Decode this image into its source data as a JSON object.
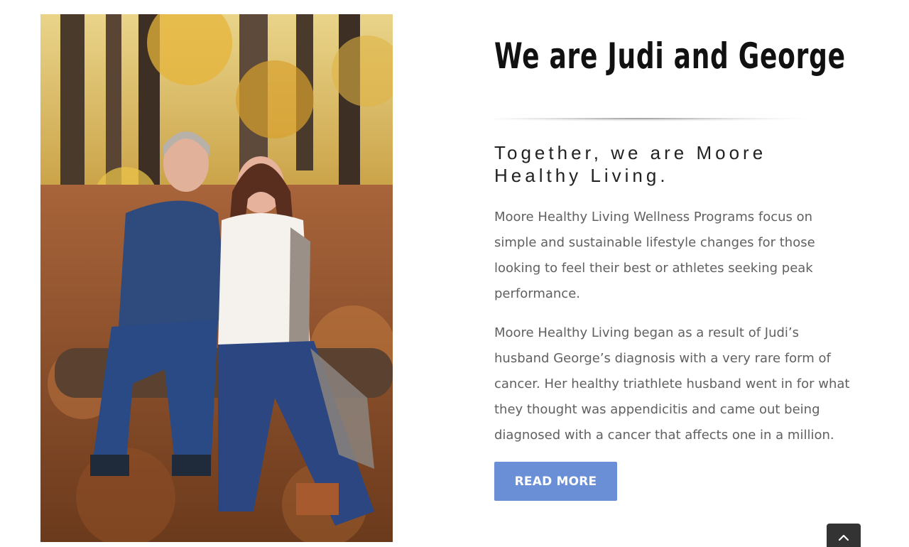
{
  "about": {
    "photo_alt": "Judi and George seated on a log in an autumn forest",
    "title": "We are Judi and George",
    "subtitle": "Together, we are Moore Healthy Living.",
    "paragraphs": [
      "Moore Healthy Living Wellness Programs focus on simple and sustainable lifestyle changes for those looking to feel their best or athletes seeking peak performance.",
      "Moore Healthy Living began as a result of Judi’s husband George’s diagnosis with a very rare form of cancer. Her healthy triathlete husband went in for what they thought was appendicitis and came out being diagnosed with a cancer that affects one in a million."
    ],
    "read_more_label": "READ MORE"
  },
  "to_top": {
    "icon": "chevron-up-icon",
    "aria_label": "Go to Top"
  },
  "colors": {
    "button": "#6b8fd6",
    "title": "#111111",
    "body_text": "#606060",
    "to_top_bg": "#333333"
  }
}
